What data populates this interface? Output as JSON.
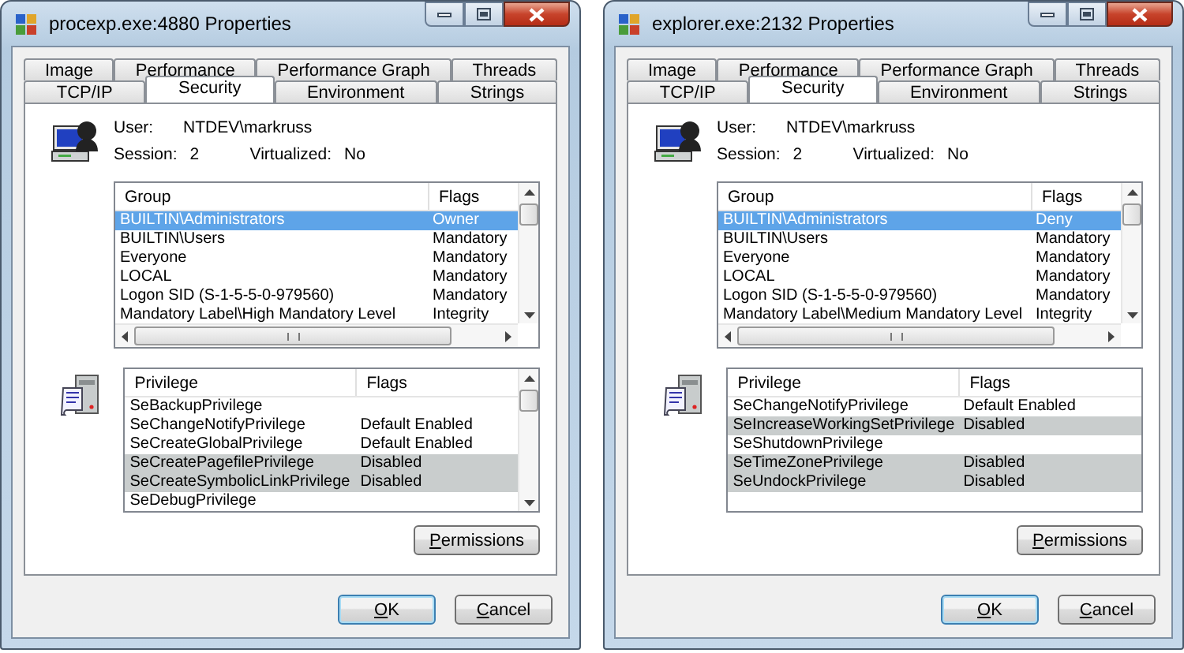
{
  "windows": [
    {
      "title": "procexp.exe:4880 Properties",
      "tab_rows": [
        [
          {
            "label": "Image",
            "selected": false
          },
          {
            "label": "Performance",
            "selected": false
          },
          {
            "label": "Performance Graph",
            "selected": false
          },
          {
            "label": "Threads",
            "selected": false
          }
        ],
        [
          {
            "label": "TCP/IP",
            "selected": false
          },
          {
            "label": "Security",
            "selected": true
          },
          {
            "label": "Environment",
            "selected": false
          },
          {
            "label": "Strings",
            "selected": false
          }
        ]
      ],
      "user_label": "User:",
      "user": "NTDEV\\markruss",
      "session_label": "Session:",
      "session": "2",
      "virtualized_label": "Virtualized:",
      "virtualized": "No",
      "groups": {
        "columns": [
          "Group",
          "Flags"
        ],
        "rows": [
          {
            "group": "BUILTIN\\Administrators",
            "flags": "Owner",
            "selected": true
          },
          {
            "group": "BUILTIN\\Users",
            "flags": "Mandatory",
            "selected": false
          },
          {
            "group": "Everyone",
            "flags": "Mandatory",
            "selected": false
          },
          {
            "group": "LOCAL",
            "flags": "Mandatory",
            "selected": false
          },
          {
            "group": "Logon SID (S-1-5-5-0-979560)",
            "flags": "Mandatory",
            "selected": false
          },
          {
            "group": "Mandatory Label\\High Mandatory Level",
            "flags": "Integrity",
            "selected": false
          }
        ]
      },
      "privileges": {
        "columns": [
          "Privilege",
          "Flags"
        ],
        "scrollable": true,
        "rows": [
          {
            "privilege": "SeBackupPrivilege",
            "disabled": false
          },
          {
            "privilege": "SeChangeNotifyPrivilege",
            "flags": "Default Enabled",
            "disabled": false
          },
          {
            "privilege": "SeCreateGlobalPrivilege",
            "flags": "Default Enabled",
            "disabled": false
          },
          {
            "privilege": "SeCreatePagefilePrivilege",
            "flags": "Disabled",
            "disabled": true
          },
          {
            "privilege": "SeCreateSymbolicLinkPrivilege",
            "flags": "Disabled",
            "disabled": true
          },
          {
            "privilege": "SeDebugPrivilege",
            "disabled": false
          }
        ]
      },
      "permissions_button": "Permissions",
      "ok_button": "OK",
      "cancel_button": "Cancel"
    },
    {
      "title": "explorer.exe:2132 Properties",
      "tab_rows": [
        [
          {
            "label": "Image",
            "selected": false
          },
          {
            "label": "Performance",
            "selected": false
          },
          {
            "label": "Performance Graph",
            "selected": false
          },
          {
            "label": "Threads",
            "selected": false
          }
        ],
        [
          {
            "label": "TCP/IP",
            "selected": false
          },
          {
            "label": "Security",
            "selected": true
          },
          {
            "label": "Environment",
            "selected": false
          },
          {
            "label": "Strings",
            "selected": false
          }
        ]
      ],
      "user_label": "User:",
      "user": "NTDEV\\markruss",
      "session_label": "Session:",
      "session": "2",
      "virtualized_label": "Virtualized:",
      "virtualized": "No",
      "groups": {
        "columns": [
          "Group",
          "Flags"
        ],
        "rows": [
          {
            "group": "BUILTIN\\Administrators",
            "flags": "Deny",
            "selected": true
          },
          {
            "group": "BUILTIN\\Users",
            "flags": "Mandatory",
            "selected": false
          },
          {
            "group": "Everyone",
            "flags": "Mandatory",
            "selected": false
          },
          {
            "group": "LOCAL",
            "flags": "Mandatory",
            "selected": false
          },
          {
            "group": "Logon SID (S-1-5-5-0-979560)",
            "flags": "Mandatory",
            "selected": false
          },
          {
            "group": "Mandatory Label\\Medium Mandatory Level",
            "flags": "Integrity",
            "selected": false
          }
        ]
      },
      "privileges": {
        "columns": [
          "Privilege",
          "Flags"
        ],
        "scrollable": false,
        "rows": [
          {
            "privilege": "SeChangeNotifyPrivilege",
            "flags": "Default Enabled",
            "disabled": false
          },
          {
            "privilege": "SeIncreaseWorkingSetPrivilege",
            "flags": "Disabled",
            "disabled": true
          },
          {
            "privilege": "SeShutdownPrivilege",
            "disabled": false
          },
          {
            "privilege": "SeTimeZonePrivilege",
            "flags": "Disabled",
            "disabled": true
          },
          {
            "privilege": "SeUndockPrivilege",
            "flags": "Disabled",
            "disabled": true
          }
        ]
      },
      "permissions_button": "Permissions",
      "ok_button": "OK",
      "cancel_button": "Cancel"
    }
  ]
}
